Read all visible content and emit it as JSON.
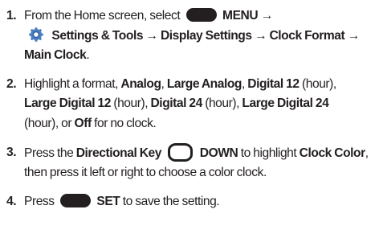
{
  "steps": [
    {
      "num": "1.",
      "p1": "From the Home screen, select",
      "menu": "MENU",
      "arrow": "→",
      "path": "Settings & Tools → Display Settings → Clock Format →",
      "main": "Main Clock",
      "end": "."
    },
    {
      "num": "2.",
      "p1": "Highlight a format,",
      "f1": "Analog",
      "s1": ",",
      "f2": "Large Analog",
      "s2": ",",
      "f3": "Digital 12",
      "t3": "(hour),",
      "f4": "Large Digital 12",
      "t4": "(hour),",
      "f5": "Digital 24",
      "t5": "(hour),",
      "f6": "Large Digital 24",
      "t6": "(hour), or",
      "f7": "Off",
      "t7": "for no clock."
    },
    {
      "num": "3.",
      "p1": "Press the",
      "dk": "Directional Key",
      "down": "DOWN",
      "p2": "to highlight",
      "cc": "Clock Color",
      "p3": ", then press it left or right to choose a color clock."
    },
    {
      "num": "4.",
      "p1": "Press",
      "set": "SET",
      "p2": "to save the setting."
    }
  ],
  "icons": {
    "softkey": "softkey-button-icon",
    "settings": "settings-gear-icon",
    "directional": "directional-key-icon"
  },
  "colors": {
    "text": "#231f20",
    "gear_ring": "#4a7fc1",
    "gear_center": "#ffffff"
  }
}
